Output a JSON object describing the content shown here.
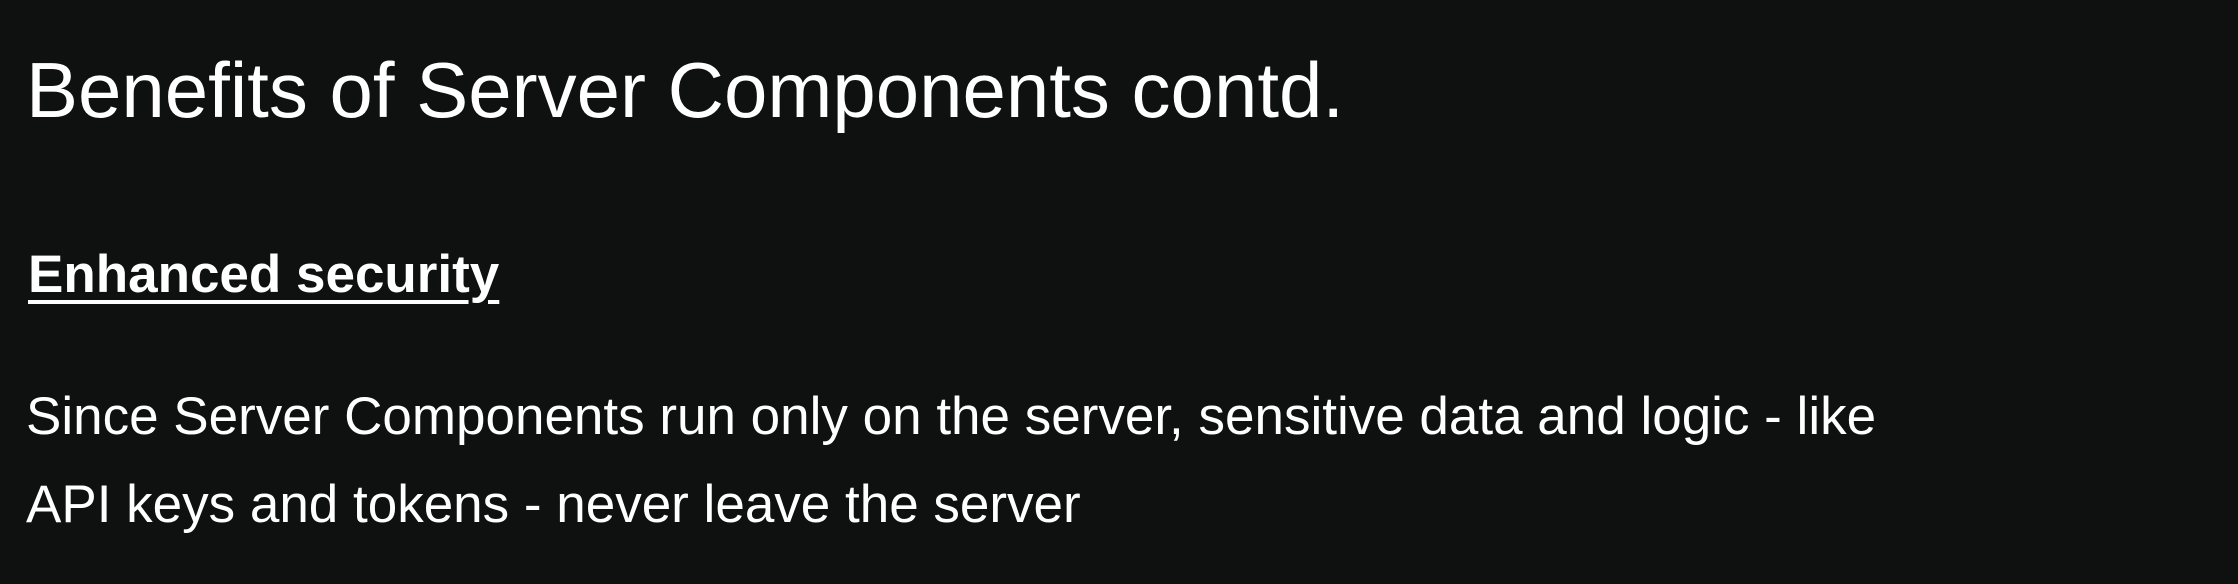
{
  "slide": {
    "title": "Benefits of Server Components contd.",
    "section_heading": "Enhanced security",
    "body": "Since Server Components run only on the server, sensitive data and logic - like\nAPI keys and tokens - never leave the server",
    "background_color": "#0f1110",
    "text_color": "#ffffff"
  }
}
